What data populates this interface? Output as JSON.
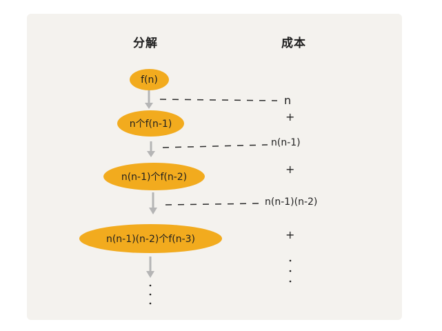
{
  "headers": {
    "decompose": "分解",
    "cost": "成本"
  },
  "nodes": [
    {
      "label": "f(n)"
    },
    {
      "label": "n个f(n-1)"
    },
    {
      "label": "n(n-1)个f(n-2)"
    },
    {
      "label": "n(n-1)(n-2)个f(n-3)"
    }
  ],
  "costs": [
    {
      "label": "n"
    },
    {
      "label": "n(n-1)"
    },
    {
      "label": "n(n-1)(n-2)"
    }
  ],
  "plus_symbol": "+",
  "colors": {
    "node_fill": "#f2ab1e",
    "arrow": "#b5b5b5",
    "background": "#f4f2ee"
  }
}
